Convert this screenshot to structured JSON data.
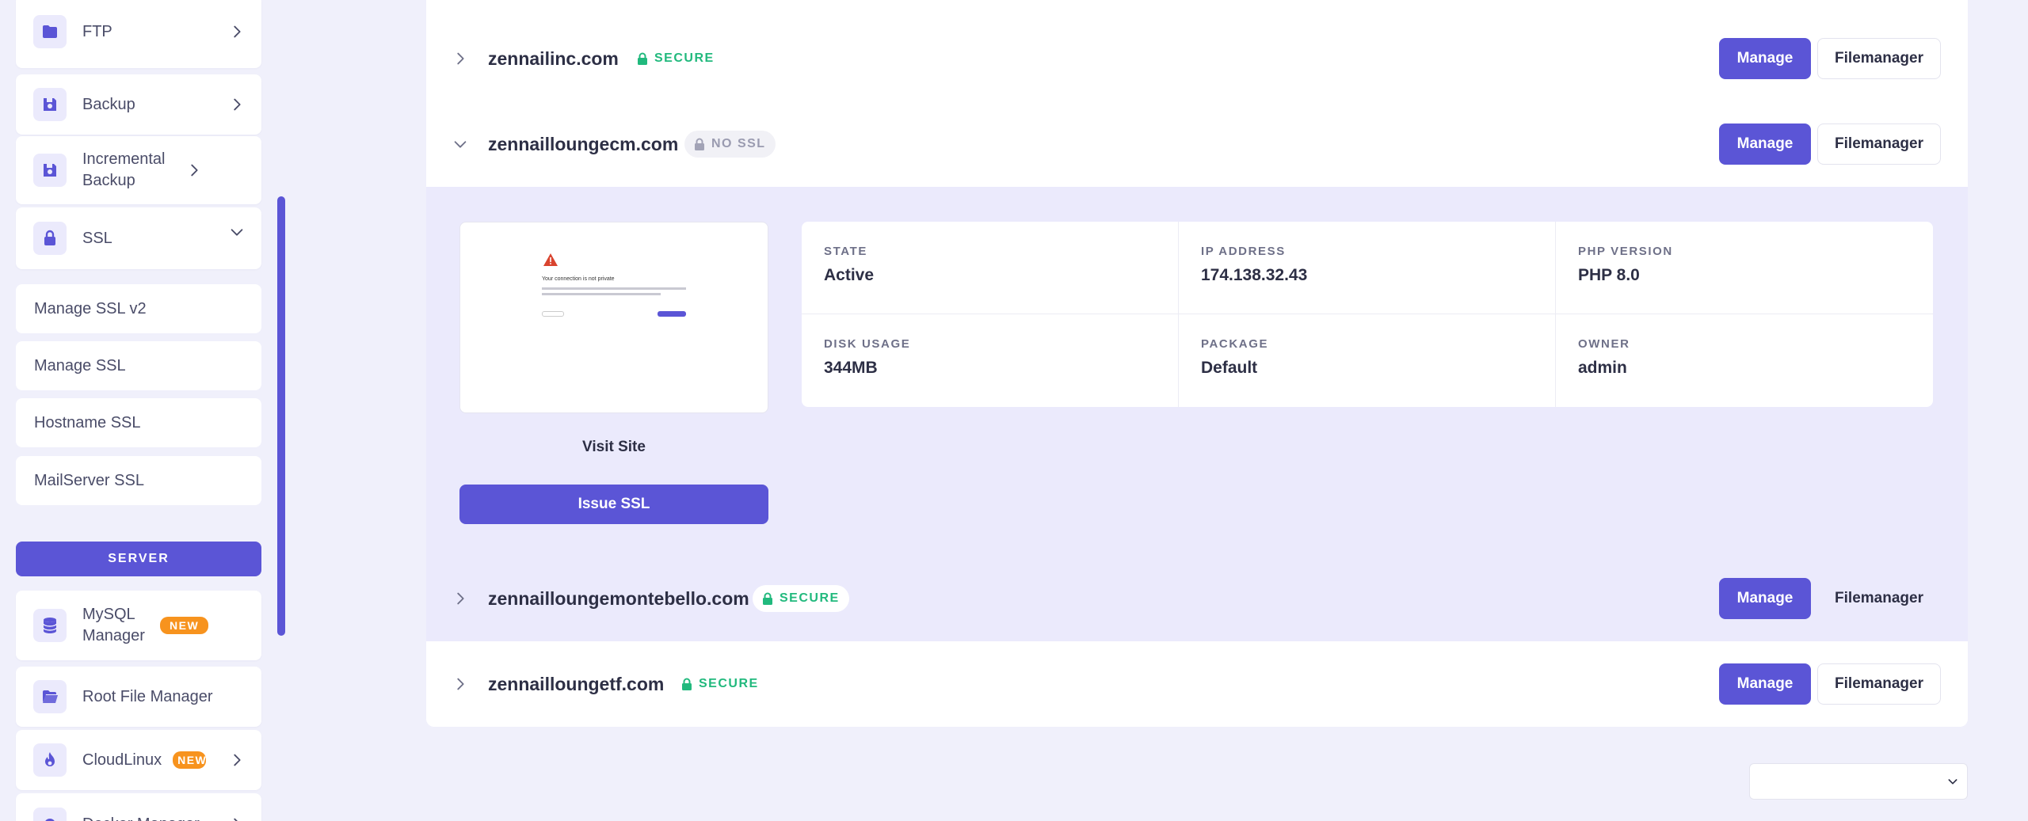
{
  "sidebar": {
    "items": [
      {
        "label": "FTP",
        "icon": "folder-icon"
      },
      {
        "label": "Backup",
        "icon": "save-icon"
      },
      {
        "label": "Incremental Backup",
        "icon": "save-icon"
      },
      {
        "label": "SSL",
        "icon": "lock-icon"
      }
    ],
    "ssl_subitems": [
      "Manage SSL v2",
      "Manage SSL",
      "Hostname SSL",
      "MailServer SSL"
    ],
    "section_server": "SERVER",
    "server_items": [
      {
        "label": "MySQL Manager",
        "badge": "NEW",
        "icon": "database-icon"
      },
      {
        "label": "Root File Manager",
        "icon": "folder-open-icon"
      },
      {
        "label": "CloudLinux",
        "badge": "NEW",
        "icon": "flame-icon"
      },
      {
        "label": "Docker Manager",
        "icon": "gear-icon"
      }
    ]
  },
  "sites": [
    {
      "domain": "zennailinc.com",
      "status": "SECURE",
      "manage": "Manage",
      "filemanager": "Filemanager"
    },
    {
      "domain": "zennailloungecm.com",
      "status": "NO SSL",
      "manage": "Manage",
      "filemanager": "Filemanager"
    },
    {
      "domain": "zennailloungemontebello.com",
      "status": "SECURE",
      "manage": "Manage",
      "filemanager": "Filemanager"
    },
    {
      "domain": "zennailloungetf.com",
      "status": "SECURE",
      "manage": "Manage",
      "filemanager": "Filemanager"
    }
  ],
  "detail": {
    "visit_site": "Visit Site",
    "issue_ssl": "Issue SSL",
    "preview_heading": "Your connection is not private",
    "fields": [
      {
        "label": "STATE",
        "value": "Active"
      },
      {
        "label": "IP ADDRESS",
        "value": "174.138.32.43"
      },
      {
        "label": "PHP VERSION",
        "value": "PHP 8.0"
      },
      {
        "label": "DISK USAGE",
        "value": "344MB"
      },
      {
        "label": "PACKAGE",
        "value": "Default"
      },
      {
        "label": "OWNER",
        "value": "admin"
      }
    ]
  },
  "colors": {
    "accent": "#5b55d6",
    "secure": "#21b97d",
    "badge": "#f7931e",
    "background": "#f0f0fb"
  }
}
